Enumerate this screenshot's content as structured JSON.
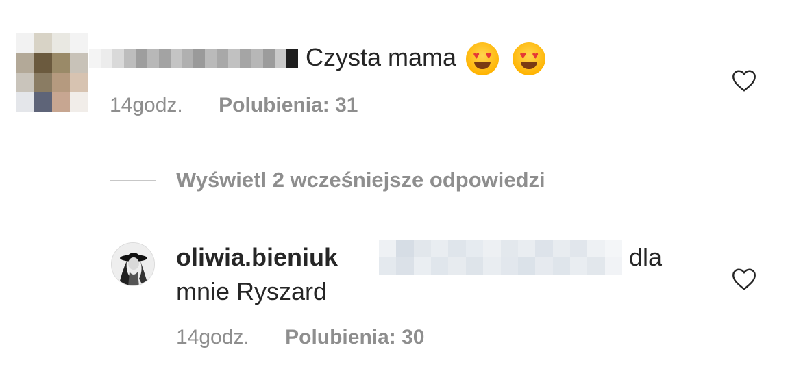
{
  "comment": {
    "text": "Czysta mama",
    "emojis": [
      "smiling-face-with-heart-eyes",
      "smiling-face-with-heart-eyes"
    ],
    "time": "14godz.",
    "likes": "Polubienia: 31"
  },
  "replies_toggle": {
    "label": "Wyświetl 2 wcześniejsze odpowiedzi"
  },
  "reply": {
    "username": "oliwia.bieniuk",
    "text_after_mention": "dla",
    "text_line2": "mnie Ryszard",
    "time": "14godz.",
    "likes": "Polubienia: 30"
  },
  "colors": {
    "text": "#262626",
    "secondary": "#8e8e8e",
    "divider": "#c7c7c7"
  },
  "icons": {
    "like": "heart-outline-icon"
  }
}
